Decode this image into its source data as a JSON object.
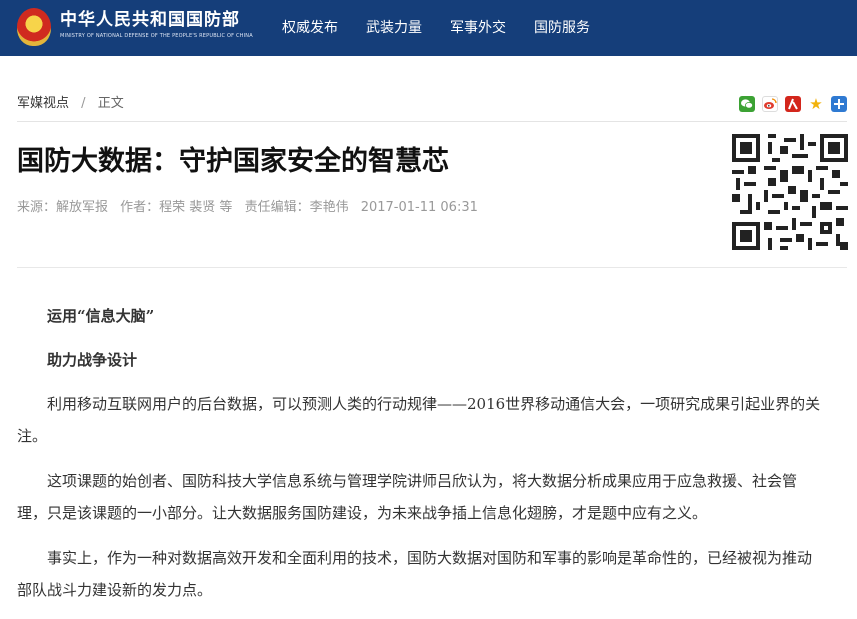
{
  "header": {
    "site_title": "中华人民共和国国防部",
    "site_subtitle": "MINISTRY OF NATIONAL DEFENSE OF THE PEOPLE'S REPUBLIC OF CHINA",
    "brand_color": "#153e7a",
    "nav": [
      "权威发布",
      "武装力量",
      "军事外交",
      "国防服务"
    ]
  },
  "breadcrumb": {
    "section": "军媒视点",
    "separator": "/",
    "current": "正文"
  },
  "share_icons": [
    "wechat-icon",
    "weibo-icon",
    "renren-icon",
    "qzone-icon",
    "more-share-icon"
  ],
  "article": {
    "title": "国防大数据：守护国家安全的智慧芯",
    "source": "来源：解放军报",
    "author": "作者：程荣 裴贤 等",
    "editor": "责任编辑：李艳伟",
    "date": "2017-01-11 06:31",
    "subheads": [
      "运用“信息大脑”",
      "助力战争设计"
    ],
    "paragraphs": [
      "利用移动互联网用户的后台数据，可以预测人类的行动规律——2016世界移动通信大会，一项研究成果引起业界的关注。",
      "这项课题的始创者、国防科技大学信息系统与管理学院讲师吕欣认为，将大数据分析成果应用于应急救援、社会管理，只是该课题的一小部分。让大数据服务国防建设，为未来战争插上信息化翅膀，才是题中应有之义。",
      "事实上，作为一种对数据高效开发和全面利用的技术，国防大数据对国防和军事的影响是革命性的，已经被视为推动部队战斗力建设新的发力点。"
    ]
  }
}
